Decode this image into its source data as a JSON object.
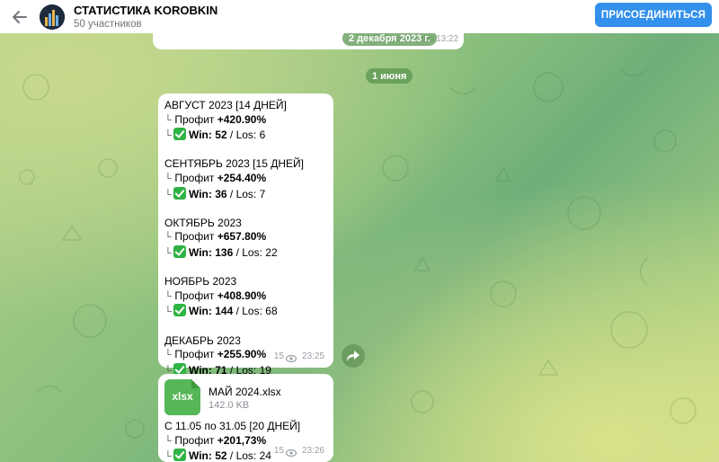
{
  "header": {
    "title": "СТАТИСТИКА KOROBKIN",
    "subtitle": "50 участников",
    "join_label": "ПРИСОЕДИНИТЬСЯ"
  },
  "previous_message": {
    "date_pill": "2 декабря 2023 г.",
    "meta": "13 👁 изменено 13:22"
  },
  "date_separator": "1 июня",
  "message1": {
    "blocks": [
      {
        "month": "АВГУСТ 2023 [14 ДНЕЙ]",
        "profit_label": "Профит ",
        "profit": "+420.90%",
        "win_label": "Win: 52",
        "loss": " / Los: 6"
      },
      {
        "month": "СЕНТЯБРЬ 2023 [15 ДНЕЙ]",
        "profit_label": "Профит ",
        "profit": "+254.40%",
        "win_label": "Win: 36",
        "loss": " / Los: 7"
      },
      {
        "month": "ОКТЯБРЬ 2023",
        "profit_label": "Профит ",
        "profit": "+657.80%",
        "win_label": "Win: 136",
        "loss": " / Los: 22"
      },
      {
        "month": "НОЯБРЬ 2023",
        "profit_label": "Профит ",
        "profit": "+408.90%",
        "win_label": "Win: 144",
        "loss": " / Los: 68"
      },
      {
        "month": "ДЕКАБРЬ 2023",
        "profit_label": "Профит ",
        "profit": "+255.90%",
        "win_label": "Win: 71",
        "loss": " / Los: 19"
      }
    ],
    "views": "15",
    "time": "23:25"
  },
  "message2": {
    "file_ext": "xlsx",
    "file_name": "МАЙ 2024.xlsx",
    "file_size": "142.0 KB",
    "period": "С 11.05 по 31.05 [20 ДНЕЙ]",
    "profit_label": "Профит ",
    "profit": "+201,73%",
    "win_label": "Win: 52",
    "loss": " / Los: 24",
    "views": "15",
    "time": "23:26"
  },
  "colors": {
    "accent": "#3390ec",
    "check": "#2fb344",
    "file_icon": "#56b756"
  }
}
